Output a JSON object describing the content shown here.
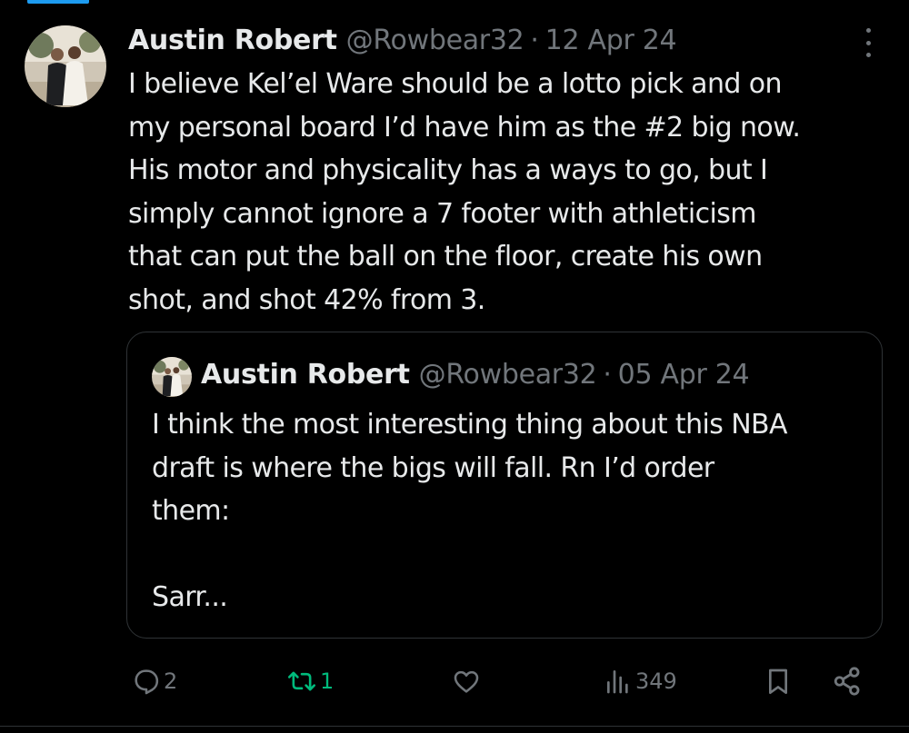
{
  "tweet": {
    "author_name": "Austin Robert",
    "handle": "@Rowbear32",
    "separator": "·",
    "date": "12 Apr 24",
    "text": "I believe Kel’el Ware should be a lotto pick and on\nmy personal board I’d have him as the #2 big now.\nHis motor and  physicality has a ways to go, but I\nsimply cannot ignore a 7 footer with athleticism\nthat can put the ball on the floor, create his own\nshot, and shot 42% from 3."
  },
  "quoted_tweet": {
    "author_name": "Austin Robert",
    "handle": "@Rowbear32",
    "separator": "·",
    "date": "05 Apr 24",
    "text": "I think the most interesting thing about this NBA\ndraft is where the bigs will fall. Rn I’d order\nthem:\n\nSarr..."
  },
  "actions": {
    "reply_count": "2",
    "retweet_count": "1",
    "like_count": "",
    "views_count": "349"
  },
  "icons": {
    "reply": "speech-bubble-icon",
    "retweet": "retweet-arrows-icon",
    "like": "heart-icon",
    "views": "bar-chart-icon",
    "bookmark": "bookmark-icon",
    "share": "share-nodes-icon",
    "more": "vertical-ellipsis-icon"
  },
  "colors": {
    "background": "#000000",
    "text_primary": "#e7e9ea",
    "text_secondary": "#71767b",
    "retweet_active": "#00ba7c",
    "border": "#2f3336",
    "accent": "#1d9bf0"
  }
}
